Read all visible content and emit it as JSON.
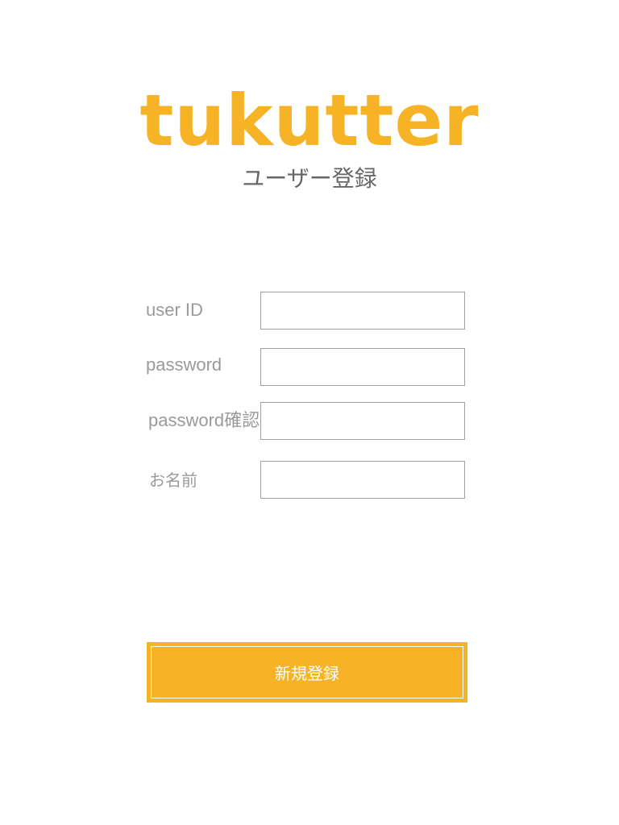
{
  "app": {
    "logo": "tukutter",
    "subtitle": "ユーザー登録"
  },
  "form": {
    "user_id": {
      "label": "user ID",
      "value": "",
      "placeholder": ""
    },
    "password": {
      "label": "password",
      "value": "",
      "placeholder": ""
    },
    "password_confirm": {
      "label": "password確認",
      "value": "",
      "placeholder": ""
    },
    "name": {
      "label": "お名前",
      "value": "",
      "placeholder": ""
    }
  },
  "submit": {
    "label": "新規登録"
  },
  "colors": {
    "brand": "#f5b325",
    "label_text": "#9a9a9a",
    "subtitle_text": "#666666",
    "input_border": "#9e9e9e",
    "button_text": "#ffffff"
  }
}
